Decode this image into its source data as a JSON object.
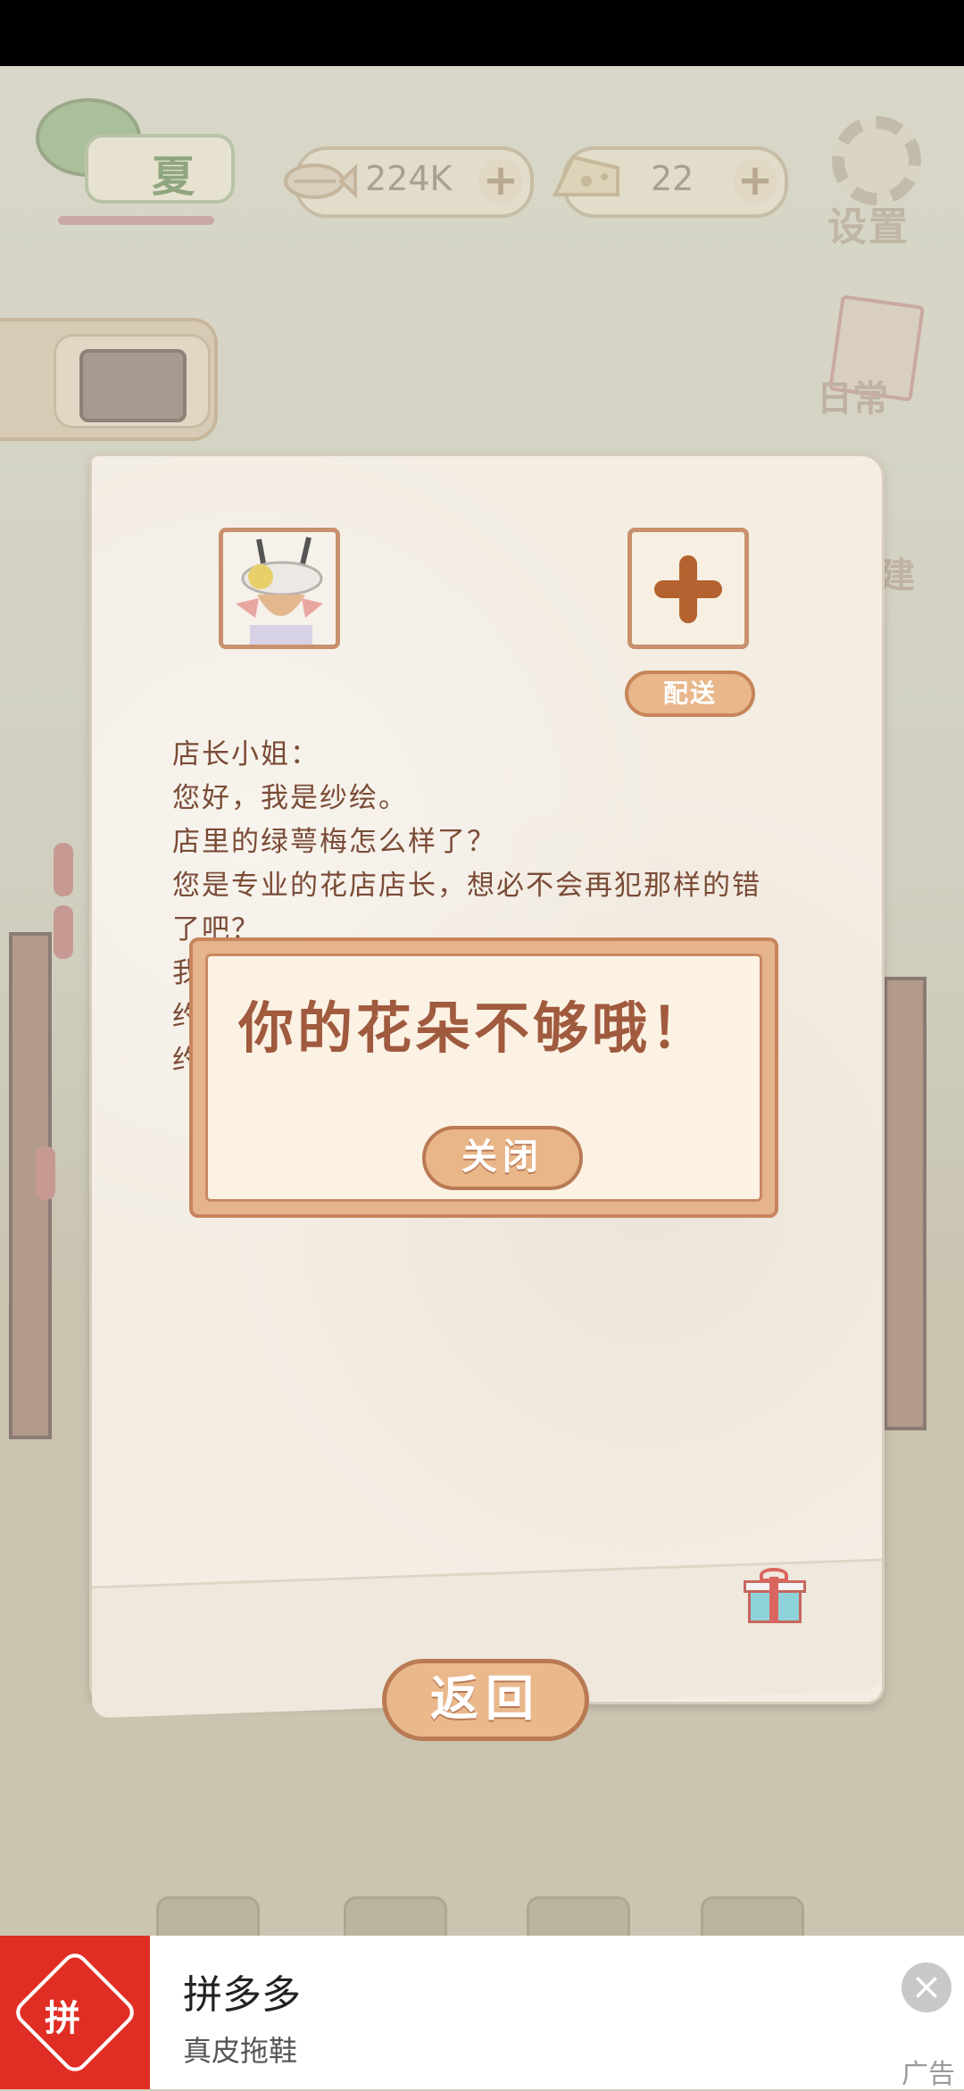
{
  "hud": {
    "season_label": "夏",
    "fish_value": "224K",
    "cheese_value": "22",
    "plus_symbol": "+",
    "settings_label": "设置",
    "daily_label": "日常",
    "build_label": "建"
  },
  "letter": {
    "deliver_label": "配送",
    "lines": [
      "店长小姐：",
      "您好，我是纱绘。",
      "店里的绿萼梅怎么样了？",
      "您是专业的花店店长，想必不会再犯那样的错",
      "了吧？",
      "我",
      "约",
      "约"
    ],
    "back_label": "返回"
  },
  "alert": {
    "message": "你的花朵不够哦！",
    "close_label": "关闭"
  },
  "ad": {
    "logo_text": "拼",
    "title": "拼多多",
    "subtitle": "真皮拖鞋",
    "close_symbol": "×",
    "tag": "广告"
  },
  "colors": {
    "accent": "#e9b88b",
    "accent_border": "#b97a54",
    "letter_text": "#7a4b36",
    "ad_brand": "#e02e24"
  }
}
